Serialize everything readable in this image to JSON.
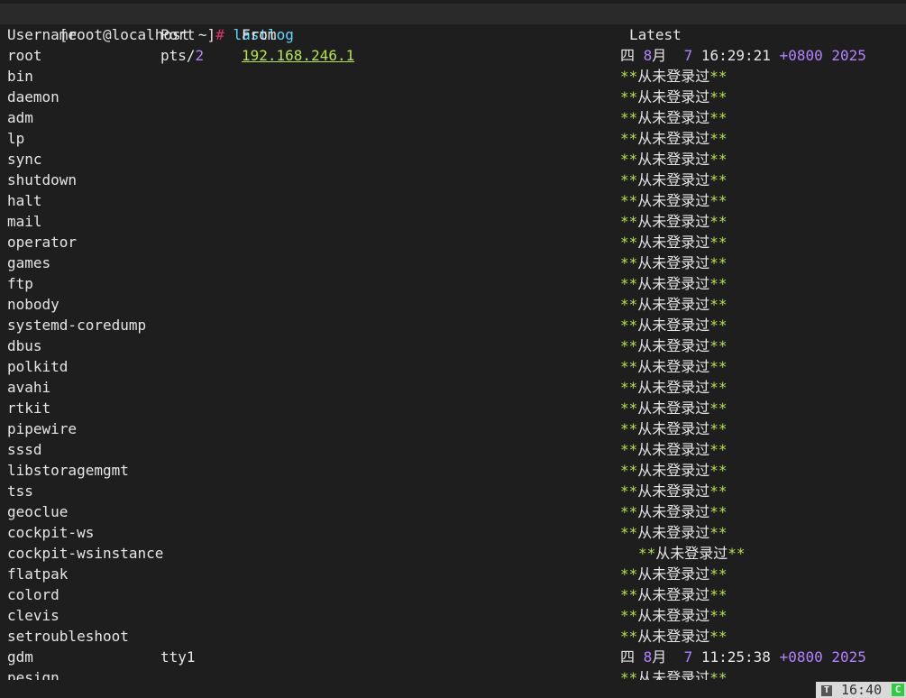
{
  "prompt": {
    "user_host": "[root@localhost ~]",
    "symbol": "#",
    "command": "lastlog"
  },
  "headers": {
    "username": "Username",
    "port": "Port",
    "from": "From",
    "latest": "Latest"
  },
  "never_logged": "从未登录过",
  "rows": [
    {
      "user": "root",
      "port": "pts/2",
      "from": "192.168.246.1",
      "latest": {
        "weekday": "四",
        "month_num": "8",
        "month_unit": "月",
        "day": "7",
        "time": "16:29:21",
        "tz": "+0800",
        "year": "2025"
      }
    },
    {
      "user": "bin"
    },
    {
      "user": "daemon"
    },
    {
      "user": "adm"
    },
    {
      "user": "lp"
    },
    {
      "user": "sync"
    },
    {
      "user": "shutdown"
    },
    {
      "user": "halt"
    },
    {
      "user": "mail"
    },
    {
      "user": "operator"
    },
    {
      "user": "games"
    },
    {
      "user": "ftp"
    },
    {
      "user": "nobody"
    },
    {
      "user": "systemd-coredump"
    },
    {
      "user": "dbus"
    },
    {
      "user": "polkitd"
    },
    {
      "user": "avahi"
    },
    {
      "user": "rtkit"
    },
    {
      "user": "pipewire"
    },
    {
      "user": "sssd"
    },
    {
      "user": "libstoragemgmt"
    },
    {
      "user": "tss"
    },
    {
      "user": "geoclue"
    },
    {
      "user": "cockpit-ws"
    },
    {
      "user": "cockpit-wsinstance",
      "indent": true
    },
    {
      "user": "flatpak"
    },
    {
      "user": "colord"
    },
    {
      "user": "clevis"
    },
    {
      "user": "setroubleshoot"
    },
    {
      "user": "gdm",
      "port": "tty1",
      "latest": {
        "weekday": "四",
        "month_num": "8",
        "month_unit": "月",
        "day": "7",
        "time": "11:25:38",
        "tz": "+0800",
        "year": "2025"
      }
    },
    {
      "user": "pesign"
    }
  ],
  "statusbar": {
    "icon_letter": "T",
    "time": "16:40",
    "conn_letter": "C",
    "colors": {
      "conn": "#2ecc40"
    }
  },
  "colors": {
    "background": "#1e1e1e",
    "prompt_hash": "#e0306c",
    "command": "#5fd7ff",
    "ip": "#b5e34a",
    "numbers": "#b383ff",
    "stars": "#b5e34a"
  }
}
